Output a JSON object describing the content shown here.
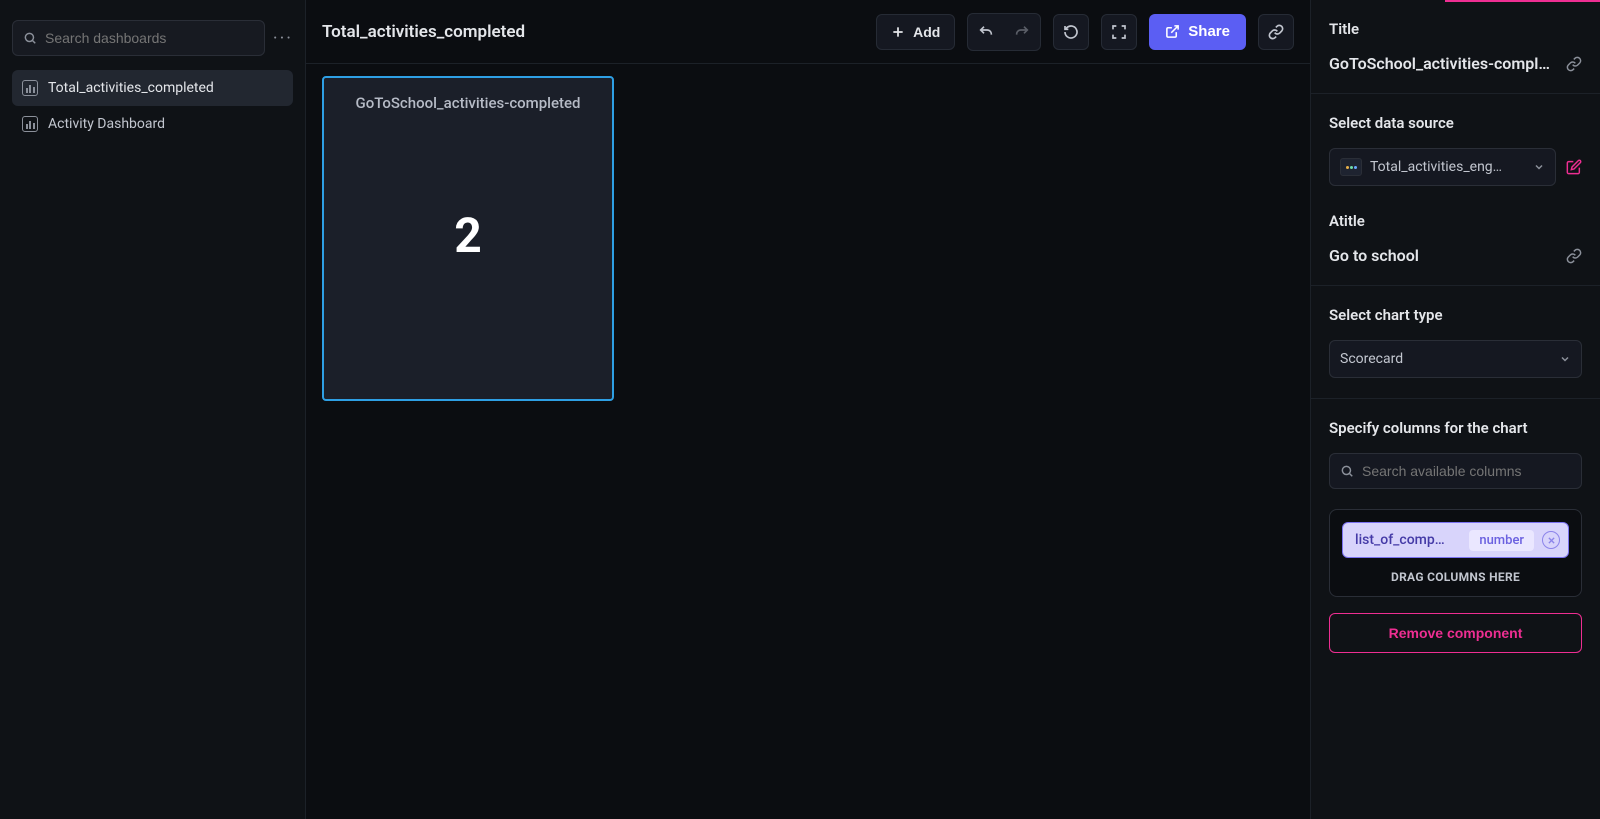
{
  "search": {
    "placeholder": "Search dashboards"
  },
  "nav": {
    "items": [
      {
        "label": "Total_activities_completed"
      },
      {
        "label": "Activity Dashboard"
      }
    ]
  },
  "toolbar": {
    "title": "Total_activities_completed",
    "add_label": "Add",
    "share_label": "Share"
  },
  "card": {
    "title": "GoToSchool_activities-completed",
    "value": "2"
  },
  "chart_data": {
    "type": "table",
    "title": "GoToSchool_activities-completed",
    "values": [
      2
    ],
    "metric": "list_of_comp…"
  },
  "panel": {
    "title_label": "Title",
    "title_value": "GoToSchool_activities-completed",
    "ds_label": "Select data source",
    "ds_value": "Total_activities_eng…",
    "atitle_label": "Atitle",
    "atitle_value": "Go to school",
    "charttype_label": "Select chart type",
    "charttype_value": "Scorecard",
    "columns_label": "Specify columns for the chart",
    "columns_search_placeholder": "Search available columns",
    "chip_name": "list_of_comp…",
    "chip_type": "number",
    "drop_hint": "DRAG COLUMNS HERE",
    "remove_label": "Remove component"
  }
}
